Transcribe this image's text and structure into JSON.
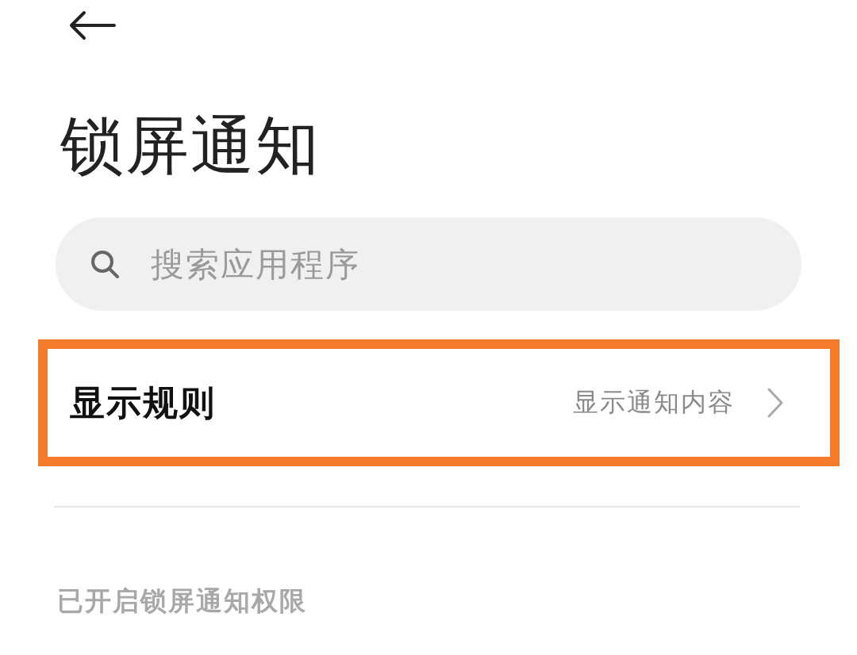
{
  "header": {
    "title": "锁屏通知"
  },
  "search": {
    "placeholder": "搜索应用程序"
  },
  "rows": [
    {
      "label": "显示规则",
      "value": "显示通知内容",
      "highlighted": true
    }
  ],
  "section": {
    "title": "已开启锁屏通知权限"
  }
}
